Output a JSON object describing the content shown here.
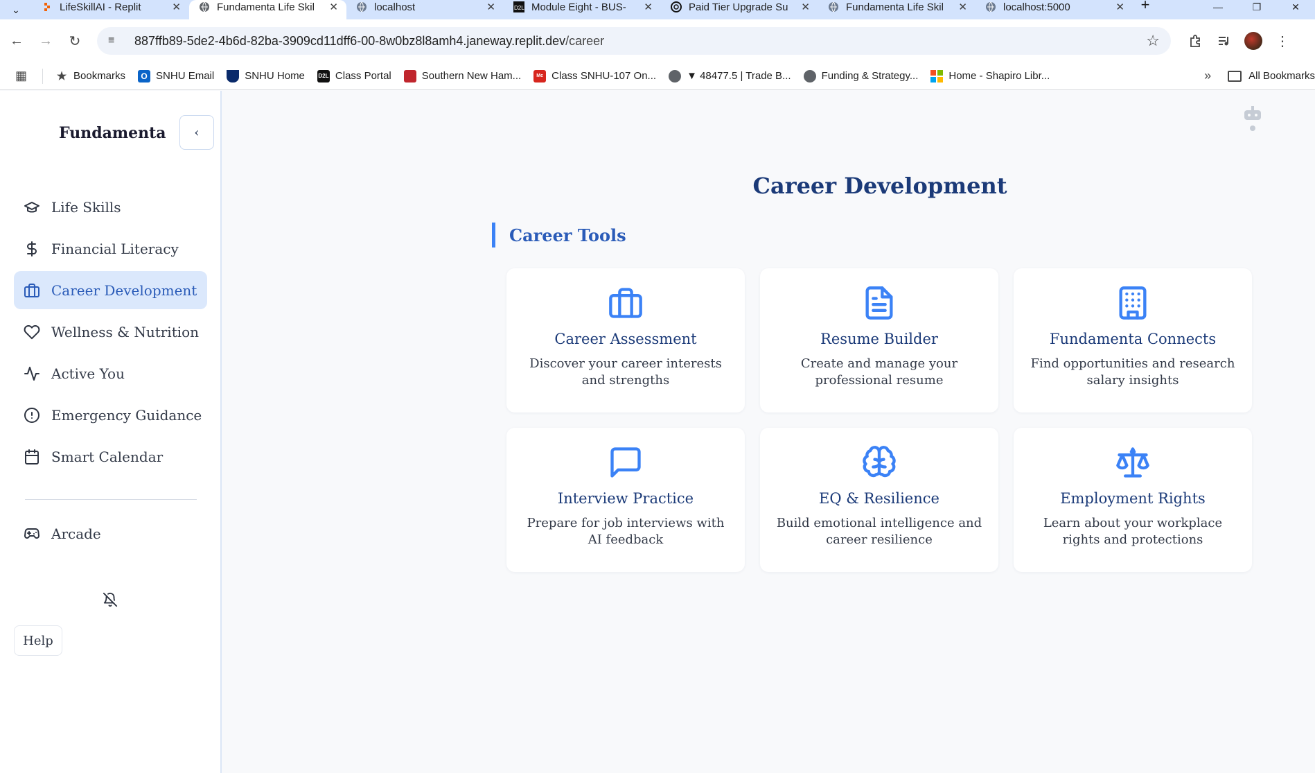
{
  "browser": {
    "tabs": [
      {
        "title": "LifeSkillAI - Replit",
        "active": false,
        "icon": "replit-icon"
      },
      {
        "title": "Fundamenta Life Skil",
        "active": true,
        "icon": "globe-icon"
      },
      {
        "title": "localhost",
        "active": false,
        "icon": "globe-icon"
      },
      {
        "title": "Module Eight - BUS-",
        "active": false,
        "icon": "d2l-icon"
      },
      {
        "title": "Paid Tier Upgrade Su",
        "active": false,
        "icon": "openai-icon"
      },
      {
        "title": "Fundamenta Life Skil",
        "active": false,
        "icon": "globe-icon"
      },
      {
        "title": "localhost:5000",
        "active": false,
        "icon": "globe-icon"
      }
    ],
    "url_host": "887ffb89-5de2-4b6d-82ba-3909cd11dff6-00-8w0bz8l8amh4.janeway.replit.dev",
    "url_path": "/career",
    "bookmarks": [
      {
        "label": "Bookmarks",
        "icon": "star-icon",
        "color": "#474747"
      },
      {
        "label": "SNHU Email",
        "icon": "outlook-icon",
        "color": "#0a64c8"
      },
      {
        "label": "SNHU Home",
        "icon": "shield-icon",
        "color": "#0a2a6a"
      },
      {
        "label": "Class Portal",
        "icon": "d2l-icon",
        "color": "#111111"
      },
      {
        "label": "Southern New Ham...",
        "icon": "books-icon",
        "color": "#c0262d"
      },
      {
        "label": "Class SNHU-107 On...",
        "icon": "mcgraw-icon",
        "color": "#d7261e"
      },
      {
        "label": "▼ 48477.5 | Trade B...",
        "icon": "globe-icon",
        "color": "#5f6368"
      },
      {
        "label": "Funding & Strategy...",
        "icon": "globe-icon",
        "color": "#5f6368"
      },
      {
        "label": "Home - Shapiro Libr...",
        "icon": "microsoft-icon",
        "color": "#f25022"
      }
    ],
    "all_bookmarks": "All Bookmarks"
  },
  "sidebar": {
    "brand": "Fundamenta",
    "items": [
      {
        "label": "Life Skills",
        "icon": "graduation-cap-icon",
        "active": false
      },
      {
        "label": "Financial Literacy",
        "icon": "dollar-icon",
        "active": false
      },
      {
        "label": "Career Development",
        "icon": "briefcase-icon",
        "active": true
      },
      {
        "label": "Wellness & Nutrition",
        "icon": "heart-icon",
        "active": false
      },
      {
        "label": "Active You",
        "icon": "activity-icon",
        "active": false
      },
      {
        "label": "Emergency Guidance",
        "icon": "alert-circle-icon",
        "active": false
      },
      {
        "label": "Smart Calendar",
        "icon": "calendar-icon",
        "active": false
      }
    ],
    "arcade": {
      "label": "Arcade",
      "icon": "gamepad-icon"
    },
    "help": "Help"
  },
  "main": {
    "title": "Career Development",
    "section": "Career Tools",
    "cards": [
      {
        "title": "Career Assessment",
        "desc": "Discover your career interests and strengths",
        "icon": "briefcase-icon"
      },
      {
        "title": "Resume Builder",
        "desc": "Create and manage your professional resume",
        "icon": "document-icon"
      },
      {
        "title": "Fundamenta Connects",
        "desc": "Find opportunities and research salary insights",
        "icon": "building-icon"
      },
      {
        "title": "Interview Practice",
        "desc": "Prepare for job interviews with AI feedback",
        "icon": "message-square-icon"
      },
      {
        "title": "EQ & Resilience",
        "desc": "Build emotional intelligence and career resilience",
        "icon": "brain-icon"
      },
      {
        "title": "Employment Rights",
        "desc": "Learn about your workplace rights and protections",
        "icon": "scale-icon"
      }
    ]
  },
  "colors": {
    "accent": "#3b82f6",
    "title": "#1b3a78",
    "active_bg": "#dbe8fc"
  }
}
